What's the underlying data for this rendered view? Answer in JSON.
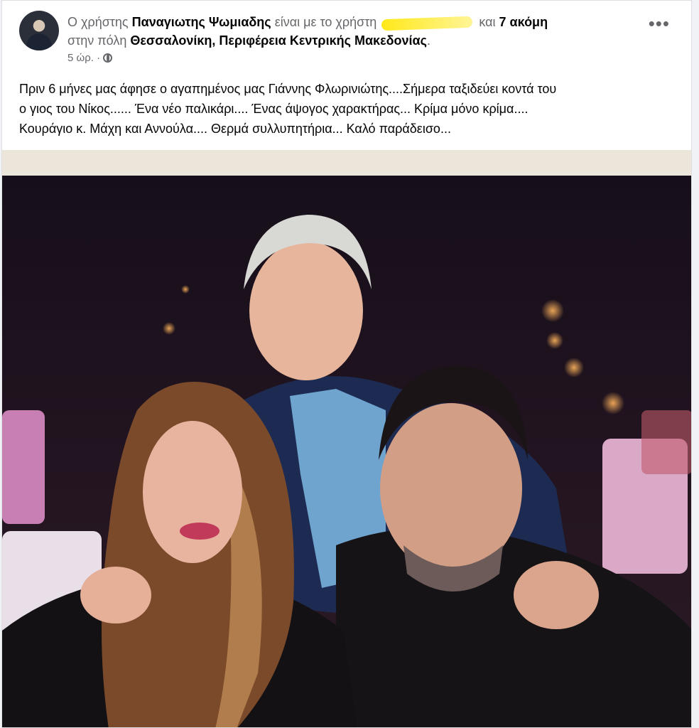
{
  "post": {
    "author_prefix": "Ο χρήστης",
    "author_name": "Παναγιωτης Ψωμιαδης",
    "with_text": "είναι με το χρήστη",
    "and_text": "και",
    "others_text": "7 ακόμη",
    "location_prefix": "στην πόλη",
    "location_name": "Θεσσαλονίκη, Περιφέρεια Κεντρικής Μακεδονίας",
    "time": "5 ώρ. ·",
    "privacy_icon": "globe-icon",
    "more_label": "•••",
    "text_lines": [
      "Πριν 6 μήνες μας άφησε ο αγαπημένος μας Γιάννης Φλωρινιώτης....Σήμερα ταξιδεύει κοντά του",
      "ο γιος του Νίκος...... Ένα νέο παλικάρι.... Ένας άψογος χαρακτήρας... Κρίμα μόνο κρίμα....",
      "Κουράγιο κ. Μάχη και  Αννούλα.... Θερμά συλλυπητήρια... Καλό παράδεισο..."
    ]
  },
  "colors": {
    "background": "#f0f2f5",
    "card": "#ffffff",
    "secondary_text": "#65676b",
    "primary_text": "#050505",
    "highlight": "#ffe600"
  }
}
